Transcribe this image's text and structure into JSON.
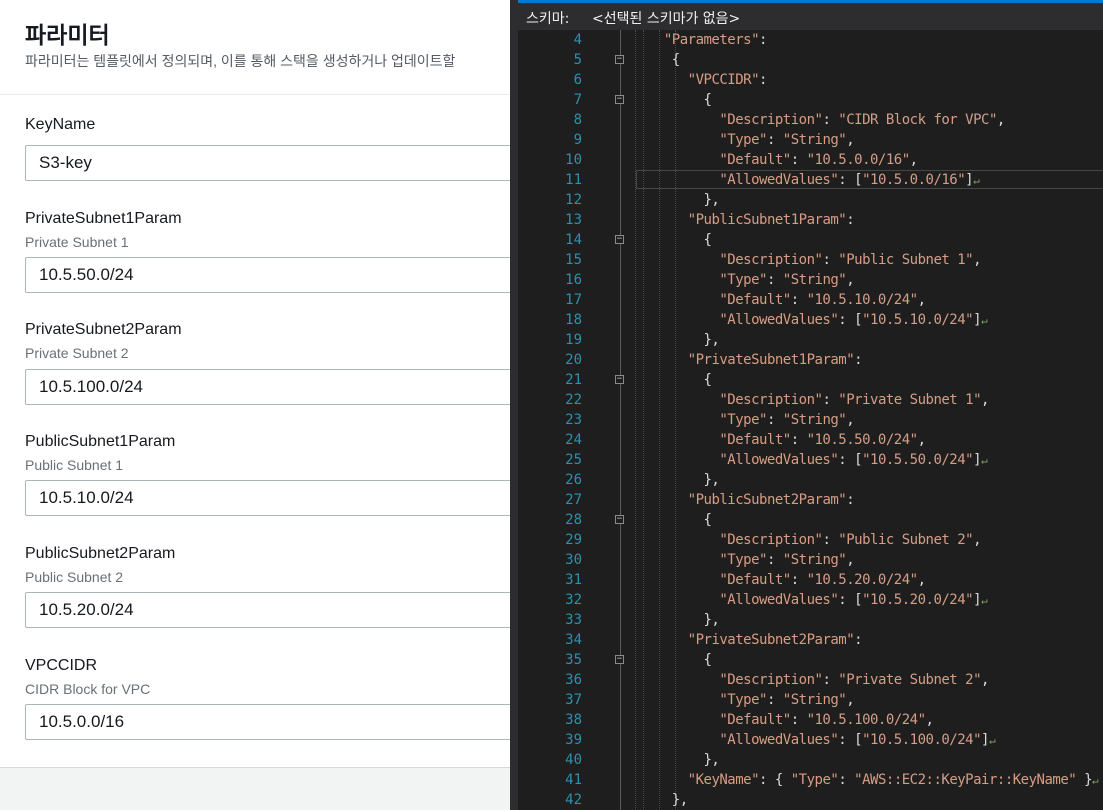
{
  "console": {
    "title": "파라미터",
    "description": "파라미터는 템플릿에서 정의되며, 이를 통해 스택을 생성하거나 업데이트할",
    "fields": [
      {
        "name": "KeyName",
        "description": "",
        "value": "S3-key"
      },
      {
        "name": "PrivateSubnet1Param",
        "description": "Private Subnet 1",
        "value": "10.5.50.0/24"
      },
      {
        "name": "PrivateSubnet2Param",
        "description": "Private Subnet 2",
        "value": "10.5.100.0/24"
      },
      {
        "name": "PublicSubnet1Param",
        "description": "Public Subnet 1",
        "value": "10.5.10.0/24"
      },
      {
        "name": "PublicSubnet2Param",
        "description": "Public Subnet 2",
        "value": "10.5.20.0/24"
      },
      {
        "name": "VPCCIDR",
        "description": "CIDR Block for VPC",
        "value": "10.5.0.0/16"
      }
    ]
  },
  "editor": {
    "schema_label": "스키마:",
    "schema_value": "<선택된 스키마가 없음>",
    "lines": [
      {
        "n": "4",
        "fold": false,
        "text": "  \"Parameters\":"
      },
      {
        "n": "5",
        "fold": true,
        "text": "   {"
      },
      {
        "n": "6",
        "fold": false,
        "text": "     \"VPCCIDR\":"
      },
      {
        "n": "7",
        "fold": true,
        "text": "       {"
      },
      {
        "n": "8",
        "fold": false,
        "text": "         \"Description\": \"CIDR Block for VPC\","
      },
      {
        "n": "9",
        "fold": false,
        "text": "         \"Type\": \"String\","
      },
      {
        "n": "10",
        "fold": false,
        "text": "         \"Default\": \"10.5.0.0/16\","
      },
      {
        "n": "11",
        "fold": false,
        "text": "         \"AllowedValues\": [\"10.5.0.0/16\"]"
      },
      {
        "n": "12",
        "fold": false,
        "text": "       },"
      },
      {
        "n": "13",
        "fold": false,
        "text": "     \"PublicSubnet1Param\":"
      },
      {
        "n": "14",
        "fold": true,
        "text": "       {"
      },
      {
        "n": "15",
        "fold": false,
        "text": "         \"Description\": \"Public Subnet 1\","
      },
      {
        "n": "16",
        "fold": false,
        "text": "         \"Type\": \"String\","
      },
      {
        "n": "17",
        "fold": false,
        "text": "         \"Default\": \"10.5.10.0/24\","
      },
      {
        "n": "18",
        "fold": false,
        "text": "         \"AllowedValues\": [\"10.5.10.0/24\"]"
      },
      {
        "n": "19",
        "fold": false,
        "text": "       },"
      },
      {
        "n": "20",
        "fold": false,
        "text": "     \"PrivateSubnet1Param\":"
      },
      {
        "n": "21",
        "fold": true,
        "text": "       {"
      },
      {
        "n": "22",
        "fold": false,
        "text": "         \"Description\": \"Private Subnet 1\","
      },
      {
        "n": "23",
        "fold": false,
        "text": "         \"Type\": \"String\","
      },
      {
        "n": "24",
        "fold": false,
        "text": "         \"Default\": \"10.5.50.0/24\","
      },
      {
        "n": "25",
        "fold": false,
        "text": "         \"AllowedValues\": [\"10.5.50.0/24\"]"
      },
      {
        "n": "26",
        "fold": false,
        "text": "       },"
      },
      {
        "n": "27",
        "fold": false,
        "text": "     \"PublicSubnet2Param\":"
      },
      {
        "n": "28",
        "fold": true,
        "text": "       {"
      },
      {
        "n": "29",
        "fold": false,
        "text": "         \"Description\": \"Public Subnet 2\","
      },
      {
        "n": "30",
        "fold": false,
        "text": "         \"Type\": \"String\","
      },
      {
        "n": "31",
        "fold": false,
        "text": "         \"Default\": \"10.5.20.0/24\","
      },
      {
        "n": "32",
        "fold": false,
        "text": "         \"AllowedValues\": [\"10.5.20.0/24\"]"
      },
      {
        "n": "33",
        "fold": false,
        "text": "       },"
      },
      {
        "n": "34",
        "fold": false,
        "text": "     \"PrivateSubnet2Param\":"
      },
      {
        "n": "35",
        "fold": true,
        "text": "       {"
      },
      {
        "n": "36",
        "fold": false,
        "text": "         \"Description\": \"Private Subnet 2\","
      },
      {
        "n": "37",
        "fold": false,
        "text": "         \"Type\": \"String\","
      },
      {
        "n": "38",
        "fold": false,
        "text": "         \"Default\": \"10.5.100.0/24\","
      },
      {
        "n": "39",
        "fold": false,
        "text": "         \"AllowedValues\": [\"10.5.100.0/24\"]"
      },
      {
        "n": "40",
        "fold": false,
        "text": "       },"
      },
      {
        "n": "41",
        "fold": false,
        "text": "     \"KeyName\": { \"Type\": \"AWS::EC2::KeyPair::KeyName\" }"
      },
      {
        "n": "42",
        "fold": false,
        "text": "   },"
      }
    ]
  },
  "colors": {
    "editor_bg": "#1e1e1e",
    "line_number": "#2b91af",
    "string": "#d69d85",
    "punctuation": "#dcdcdc",
    "accent": "#007acc"
  }
}
